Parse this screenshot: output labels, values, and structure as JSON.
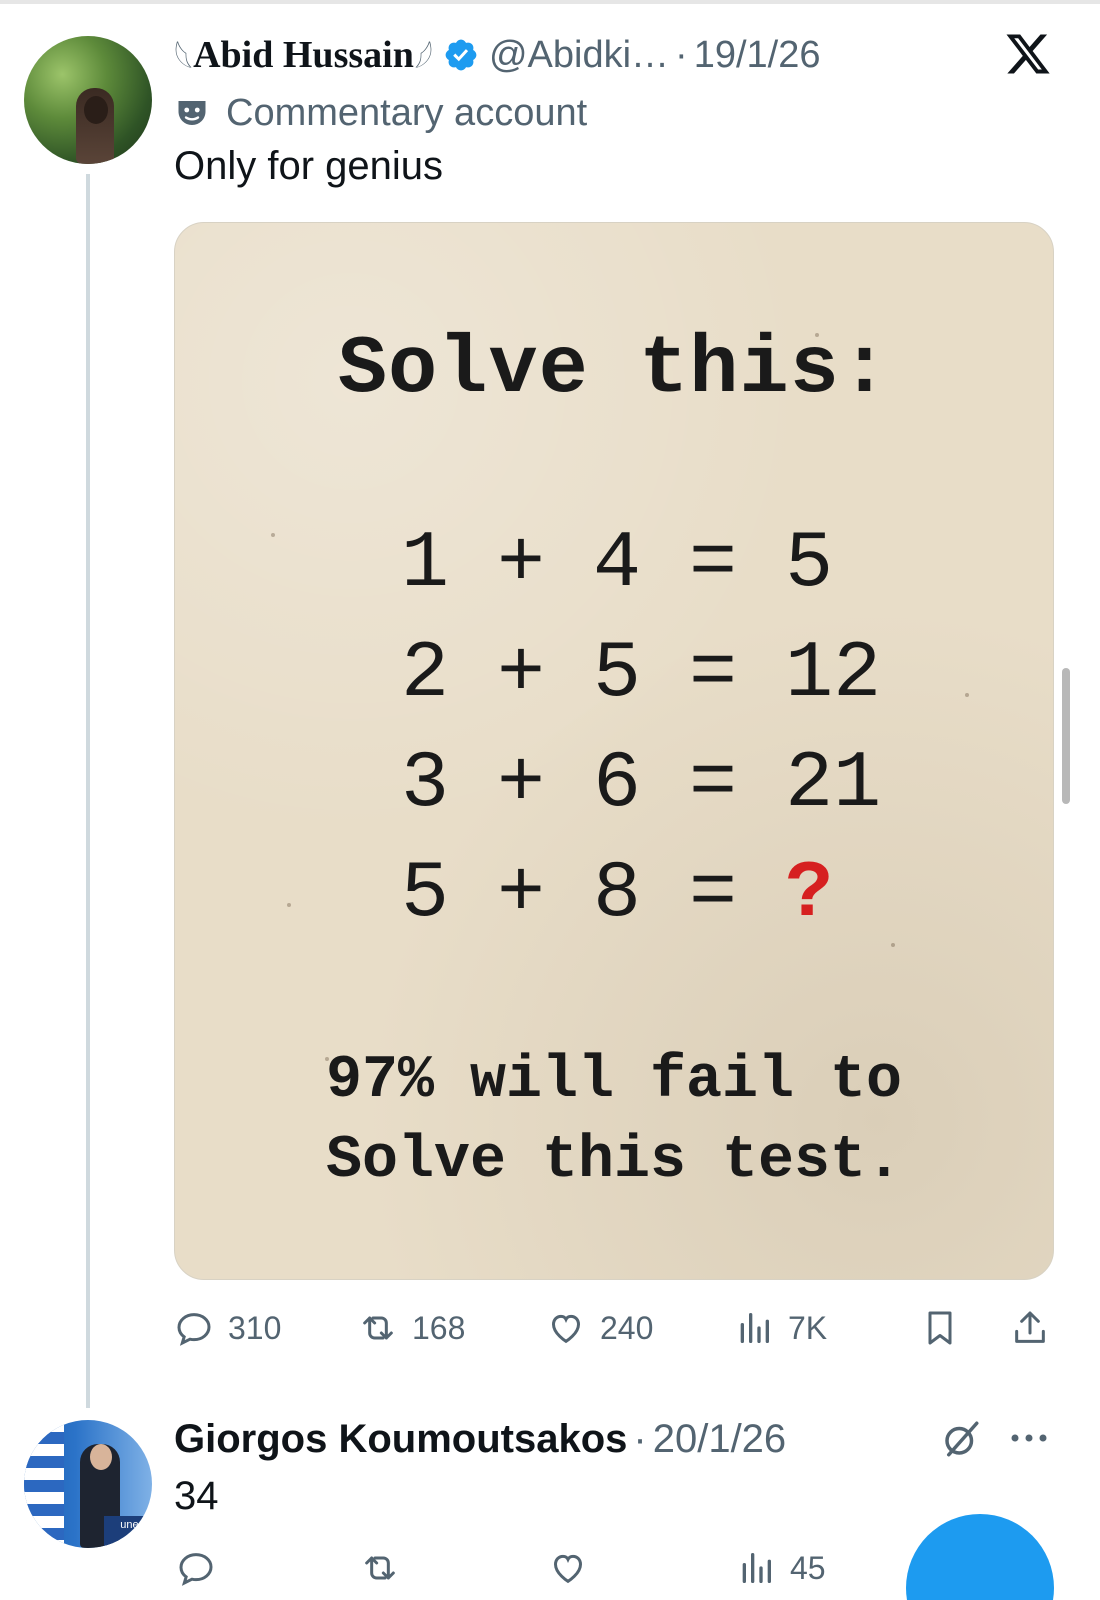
{
  "tweet": {
    "display_name": "Abid Hussain",
    "name_decoration_left": "𓆩",
    "name_decoration_right": "𓆪",
    "handle": "@Abidki…",
    "separator": "·",
    "date": "19/1/26",
    "label": "Commentary account",
    "text": "Only for genius",
    "icons": [
      "verified-badge-icon",
      "x-logo-icon",
      "commentary-mask-icon"
    ]
  },
  "media": {
    "title": "Solve this:",
    "equations": [
      {
        "text": "1 + 4 = 5",
        "answer": ""
      },
      {
        "text": "2 + 5 = 12",
        "answer": ""
      },
      {
        "text": "3 + 6 = 21",
        "answer": ""
      },
      {
        "text": "5 + 8 = ",
        "answer": "?"
      }
    ],
    "footer_line1": "97% will fail to",
    "footer_line2": "Solve this test."
  },
  "actions": {
    "replies": "310",
    "reposts": "168",
    "likes": "240",
    "views": "7K"
  },
  "reply": {
    "display_name": "Giorgos Koumoutsakos",
    "separator": "·",
    "date": "20/1/26",
    "text": "34",
    "views": "45",
    "avatar_podium_text": "unesco"
  },
  "colors": {
    "accent": "#1d9bf0",
    "text_primary": "#0f1419",
    "text_secondary": "#536471",
    "question_mark": "#d62020",
    "paper": "#e8ddc8"
  }
}
